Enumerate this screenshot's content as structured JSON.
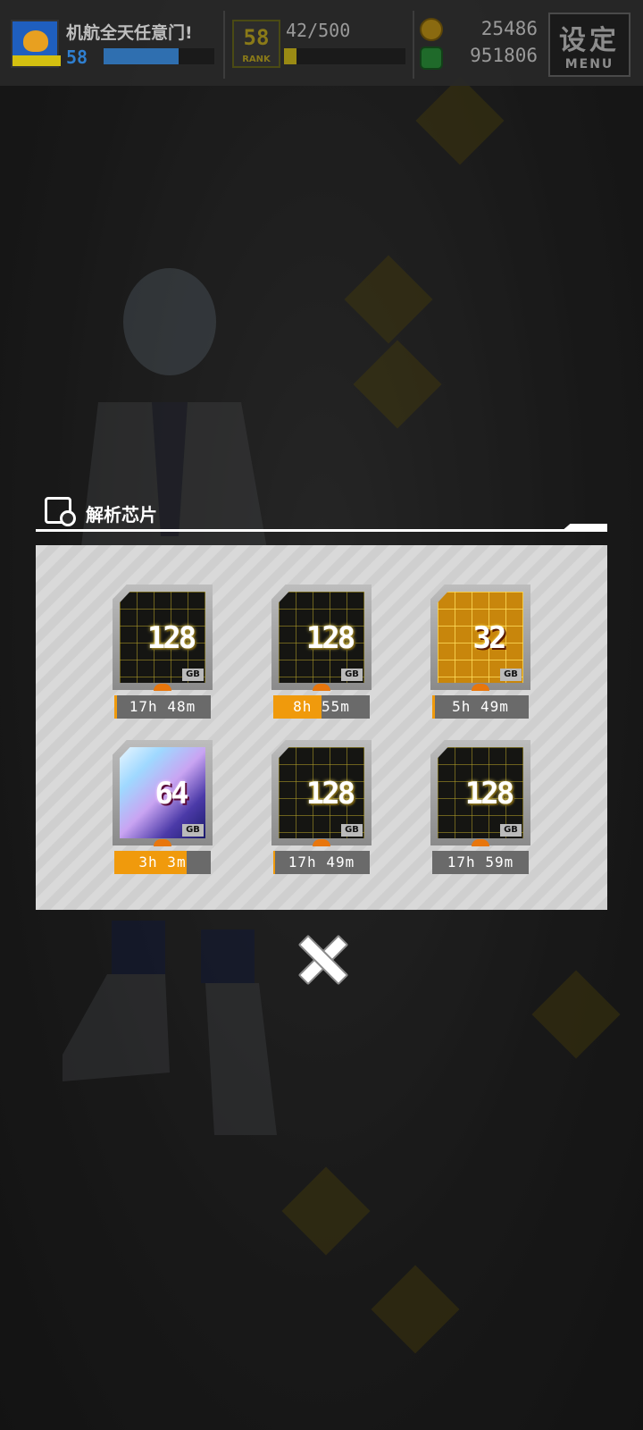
{
  "header": {
    "player_name": "机航全天任意门!",
    "player_level": "58",
    "exp_fraction": 0.68,
    "rank": "58",
    "rank_label": "RANK",
    "rank_progress": "42/500",
    "rank_fraction": 0.1,
    "coins": "25486",
    "cash": "951806",
    "menu_label": "设定",
    "menu_sublabel": "MENU"
  },
  "panel": {
    "title": "解析芯片"
  },
  "chips": [
    {
      "value": "128",
      "unit": "GB",
      "timer": "17h 48m",
      "progress": 0.03,
      "style": "dark"
    },
    {
      "value": "128",
      "unit": "GB",
      "timer": "8h 55m",
      "progress": 0.5,
      "style": "dark"
    },
    {
      "value": "32",
      "unit": "GB",
      "timer": "5h 49m",
      "progress": 0.03,
      "style": "gold"
    },
    {
      "value": "64",
      "unit": "GB",
      "timer": "3h 3m",
      "progress": 0.75,
      "style": "holo"
    },
    {
      "value": "128",
      "unit": "GB",
      "timer": "17h 49m",
      "progress": 0.02,
      "style": "dark"
    },
    {
      "value": "128",
      "unit": "GB",
      "timer": "17h 59m",
      "progress": 0.0,
      "style": "dark"
    }
  ],
  "colors": {
    "timer_fill": "#f09a0c",
    "accent_blue": "#2f7fd0"
  }
}
